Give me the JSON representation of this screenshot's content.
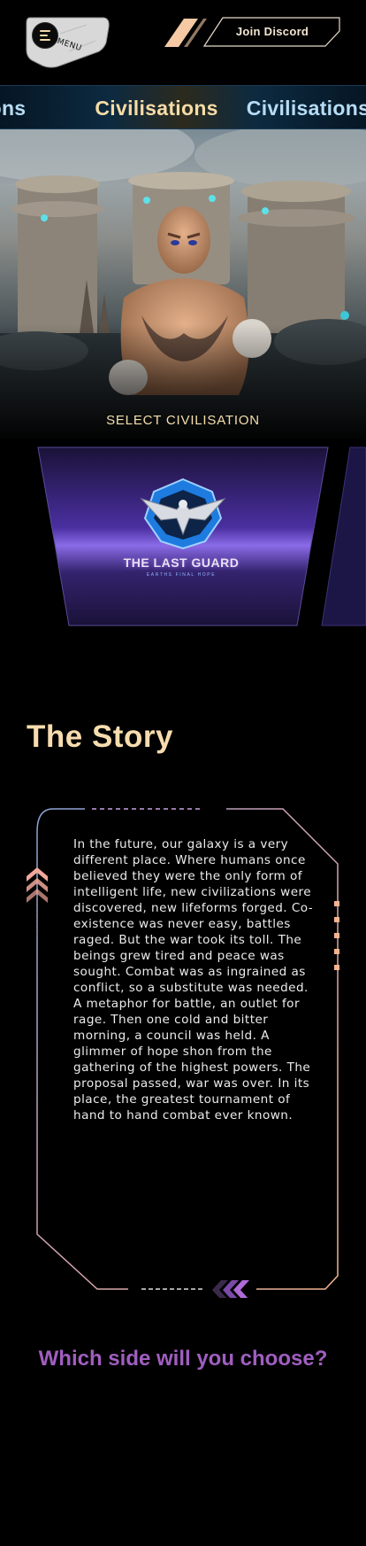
{
  "header": {
    "menu_label": "MENU",
    "discord_label": "Join Discord"
  },
  "marquee": {
    "items": [
      "Civilisations",
      "Civilisations",
      "Civilisations"
    ]
  },
  "hero": {
    "select_label": "SELECT CIVILISATION"
  },
  "cards": [
    {
      "title": "THE LAST GUARD",
      "subtitle": "EARTHS FINAL HOPE"
    }
  ],
  "story": {
    "heading": "The Story",
    "body": "In the future, our galaxy is a very different place. Where humans once believed they were the only form of intelligent life, new civilizations were discovered, new lifeforms forged. Co-existence was never easy, battles raged. But the war took its toll. The beings grew tired and peace was sought. Combat was as ingrained as conflict, so a substitute was needed. A metaphor for battle, an outlet for rage. Then one cold and bitter morning, a council was held. A glimmer of hope shon from the gathering of the highest powers. The proposal passed, war was over. In its place, the greatest tournament of hand to hand combat ever known."
  },
  "cta": {
    "question": "Which side will you choose?"
  },
  "colors": {
    "accent_gold": "#f6dcae",
    "accent_purple": "#a05ec0",
    "frame_peach": "#f3b48f",
    "frame_blue": "#8aa3d8"
  },
  "icons": [
    "menu-icon",
    "eagle-emblem-icon",
    "chevron-up-icon",
    "chevron-left-icon"
  ]
}
